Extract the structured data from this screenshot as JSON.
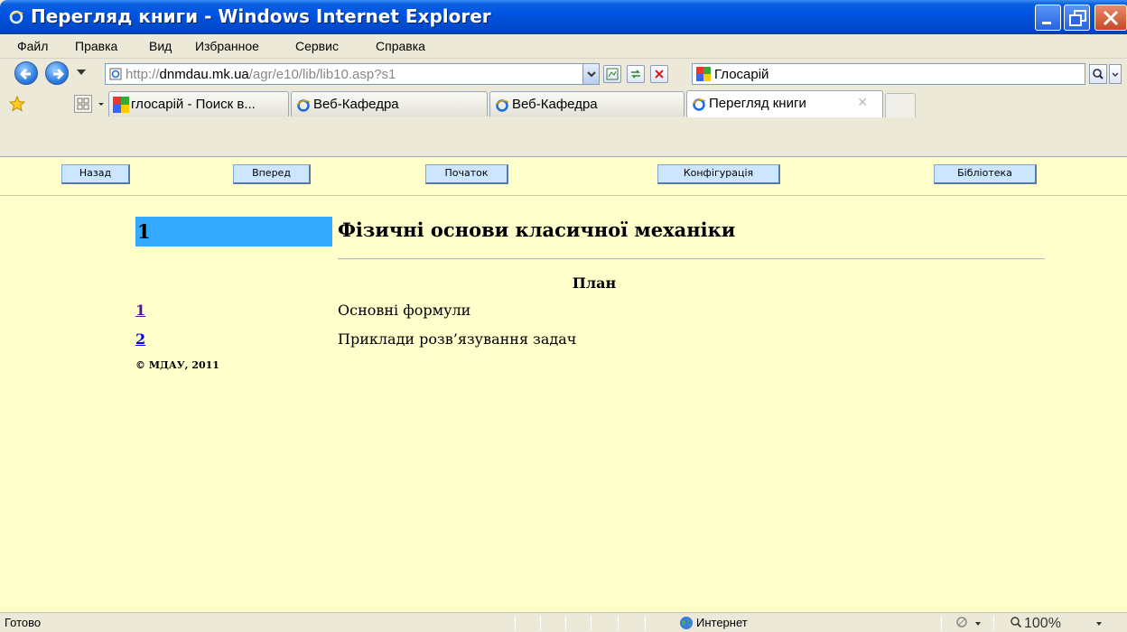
{
  "window": {
    "title": "Перегляд книги - Windows Internet Explorer"
  },
  "menu": [
    "Файл",
    "Правка",
    "Вид",
    "Избранное",
    "Сервис",
    "Справка"
  ],
  "address": {
    "prefix": "http://",
    "host": "dnmdau.mk.ua",
    "path": "/agr/e10/lib/lib10.asp?s1"
  },
  "search": {
    "value": "Глосарій"
  },
  "tabs": [
    {
      "label": "глосарій - Поиск в...",
      "active": false
    },
    {
      "label": "Веб-Кафедра",
      "active": false
    },
    {
      "label": "Веб-Кафедра",
      "active": false
    },
    {
      "label": "Перегляд книги",
      "active": true
    }
  ],
  "page_nav": [
    "Назад",
    "Вперед",
    "Початок",
    "Конфігурація",
    "Бібліотека"
  ],
  "chapter": {
    "number": "1",
    "title": "Фізичні основи класичної механіки"
  },
  "plan": {
    "heading": "План",
    "items": [
      {
        "num": "1",
        "title": "Основні формули"
      },
      {
        "num": "2",
        "title": "Приклади розв’язування задач"
      }
    ]
  },
  "footer": {
    "copyright": "© МДАУ, 2011"
  },
  "status": {
    "text": "Готово",
    "zone": "Интернет",
    "zoom": "100%"
  },
  "colors": {
    "page_background": "#ffffcc",
    "chapter_number_background": "#33aaff",
    "titlebar": "#0054e3"
  }
}
